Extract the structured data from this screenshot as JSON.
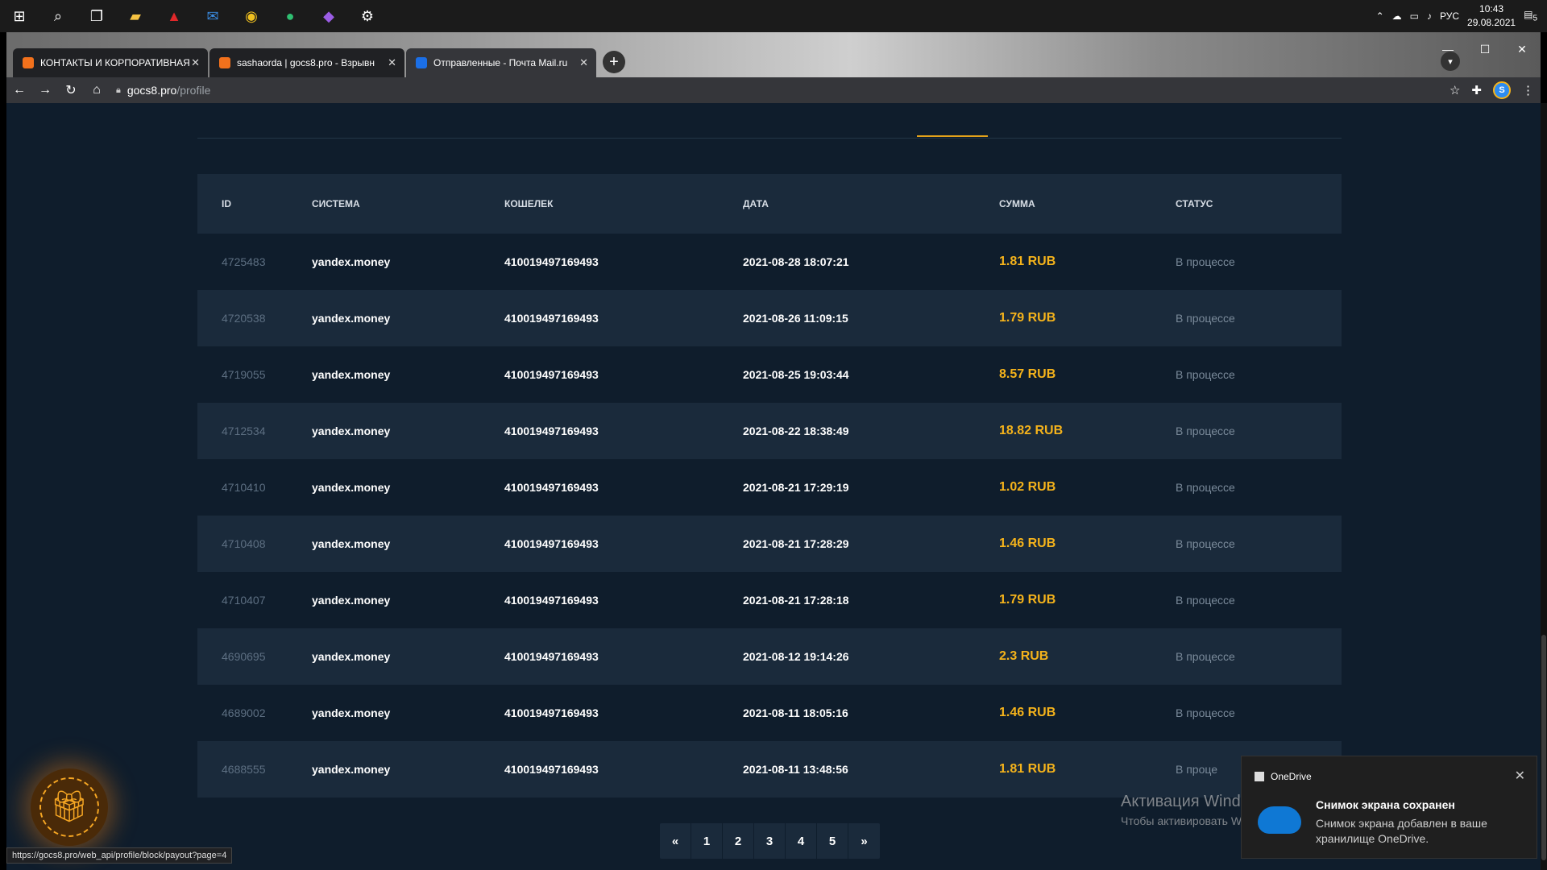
{
  "taskbar": {
    "language": "РУС",
    "time": "10:43",
    "date": "29.08.2021",
    "notification_count": "5"
  },
  "browser": {
    "tabs": [
      {
        "label": "КОНТАКТЫ И КОРПОРАТИВНАЯ",
        "favicon_color": "#f2711c"
      },
      {
        "label": "sashaorda | gocs8.pro - Взрывн",
        "favicon_color": "#f2711c"
      },
      {
        "label": "Отправленные - Почта Mail.ru",
        "favicon_color": "#1b6fe6"
      }
    ],
    "url_host": "gocs8.pro",
    "url_path": "/profile",
    "avatar_letter": "S"
  },
  "page": {
    "table": {
      "headers": [
        "ID",
        "СИСТЕМА",
        "КОШЕЛЕК",
        "ДАТА",
        "СУММА",
        "СТАТУС"
      ],
      "rows": [
        {
          "id": "4725483",
          "system": "yandex.money",
          "wallet": "410019497169493",
          "date": "2021-08-28 18:07:21",
          "amount": "1.81 RUB",
          "status": "В процессе"
        },
        {
          "id": "4720538",
          "system": "yandex.money",
          "wallet": "410019497169493",
          "date": "2021-08-26 11:09:15",
          "amount": "1.79 RUB",
          "status": "В процессе"
        },
        {
          "id": "4719055",
          "system": "yandex.money",
          "wallet": "410019497169493",
          "date": "2021-08-25 19:03:44",
          "amount": "8.57 RUB",
          "status": "В процессе"
        },
        {
          "id": "4712534",
          "system": "yandex.money",
          "wallet": "410019497169493",
          "date": "2021-08-22 18:38:49",
          "amount": "18.82 RUB",
          "status": "В процессе"
        },
        {
          "id": "4710410",
          "system": "yandex.money",
          "wallet": "410019497169493",
          "date": "2021-08-21 17:29:19",
          "amount": "1.02 RUB",
          "status": "В процессе"
        },
        {
          "id": "4710408",
          "system": "yandex.money",
          "wallet": "410019497169493",
          "date": "2021-08-21 17:28:29",
          "amount": "1.46 RUB",
          "status": "В процессе"
        },
        {
          "id": "4710407",
          "system": "yandex.money",
          "wallet": "410019497169493",
          "date": "2021-08-21 17:28:18",
          "amount": "1.79 RUB",
          "status": "В процессе"
        },
        {
          "id": "4690695",
          "system": "yandex.money",
          "wallet": "410019497169493",
          "date": "2021-08-12 19:14:26",
          "amount": "2.3 RUB",
          "status": "В процессе"
        },
        {
          "id": "4689002",
          "system": "yandex.money",
          "wallet": "410019497169493",
          "date": "2021-08-11 18:05:16",
          "amount": "1.46 RUB",
          "status": "В процессе"
        },
        {
          "id": "4688555",
          "system": "yandex.money",
          "wallet": "410019497169493",
          "date": "2021-08-11 13:48:56",
          "amount": "1.81 RUB",
          "status": "В проце"
        }
      ]
    },
    "pagination": [
      "«",
      "1",
      "2",
      "3",
      "4",
      "5",
      "»"
    ],
    "status_url": "https://gocs8.pro/web_api/profile/block/payout?page=4"
  },
  "overlay": {
    "activation_title": "Активация Windows",
    "activation_sub": "Чтобы активировать Windows, пере",
    "toast_app": "OneDrive",
    "toast_title": "Снимок экрана сохранен",
    "toast_body": "Снимок экрана добавлен в ваше хранилище OneDrive."
  },
  "colors": {
    "accent": "#f5b31b",
    "page_bg": "#0f1d2c",
    "row_alt": "#1a2a3b"
  }
}
